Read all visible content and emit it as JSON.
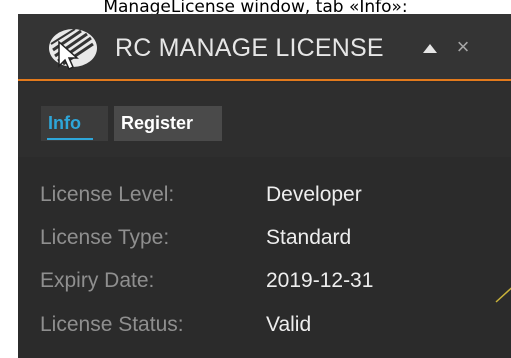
{
  "caption": "ManageLicense window, tab «Info»:",
  "window": {
    "title": "RC MANAGE LICENSE",
    "close_glyph": "×",
    "collapse_icon": "triangle-up-icon",
    "logo_icon": "rc-logo-icon",
    "accent_color": "#e37a1c"
  },
  "tabs": [
    {
      "label": "Info",
      "active": true,
      "color": "#2ea6d9"
    },
    {
      "label": "Register",
      "active": false
    }
  ],
  "info": {
    "rows": [
      {
        "label": "License Level:",
        "value": "Developer"
      },
      {
        "label": "License Type:",
        "value": "Standard"
      },
      {
        "label": "Expiry Date:",
        "value": "2019-12-31"
      },
      {
        "label": "License Status:",
        "value": "Valid"
      }
    ]
  }
}
